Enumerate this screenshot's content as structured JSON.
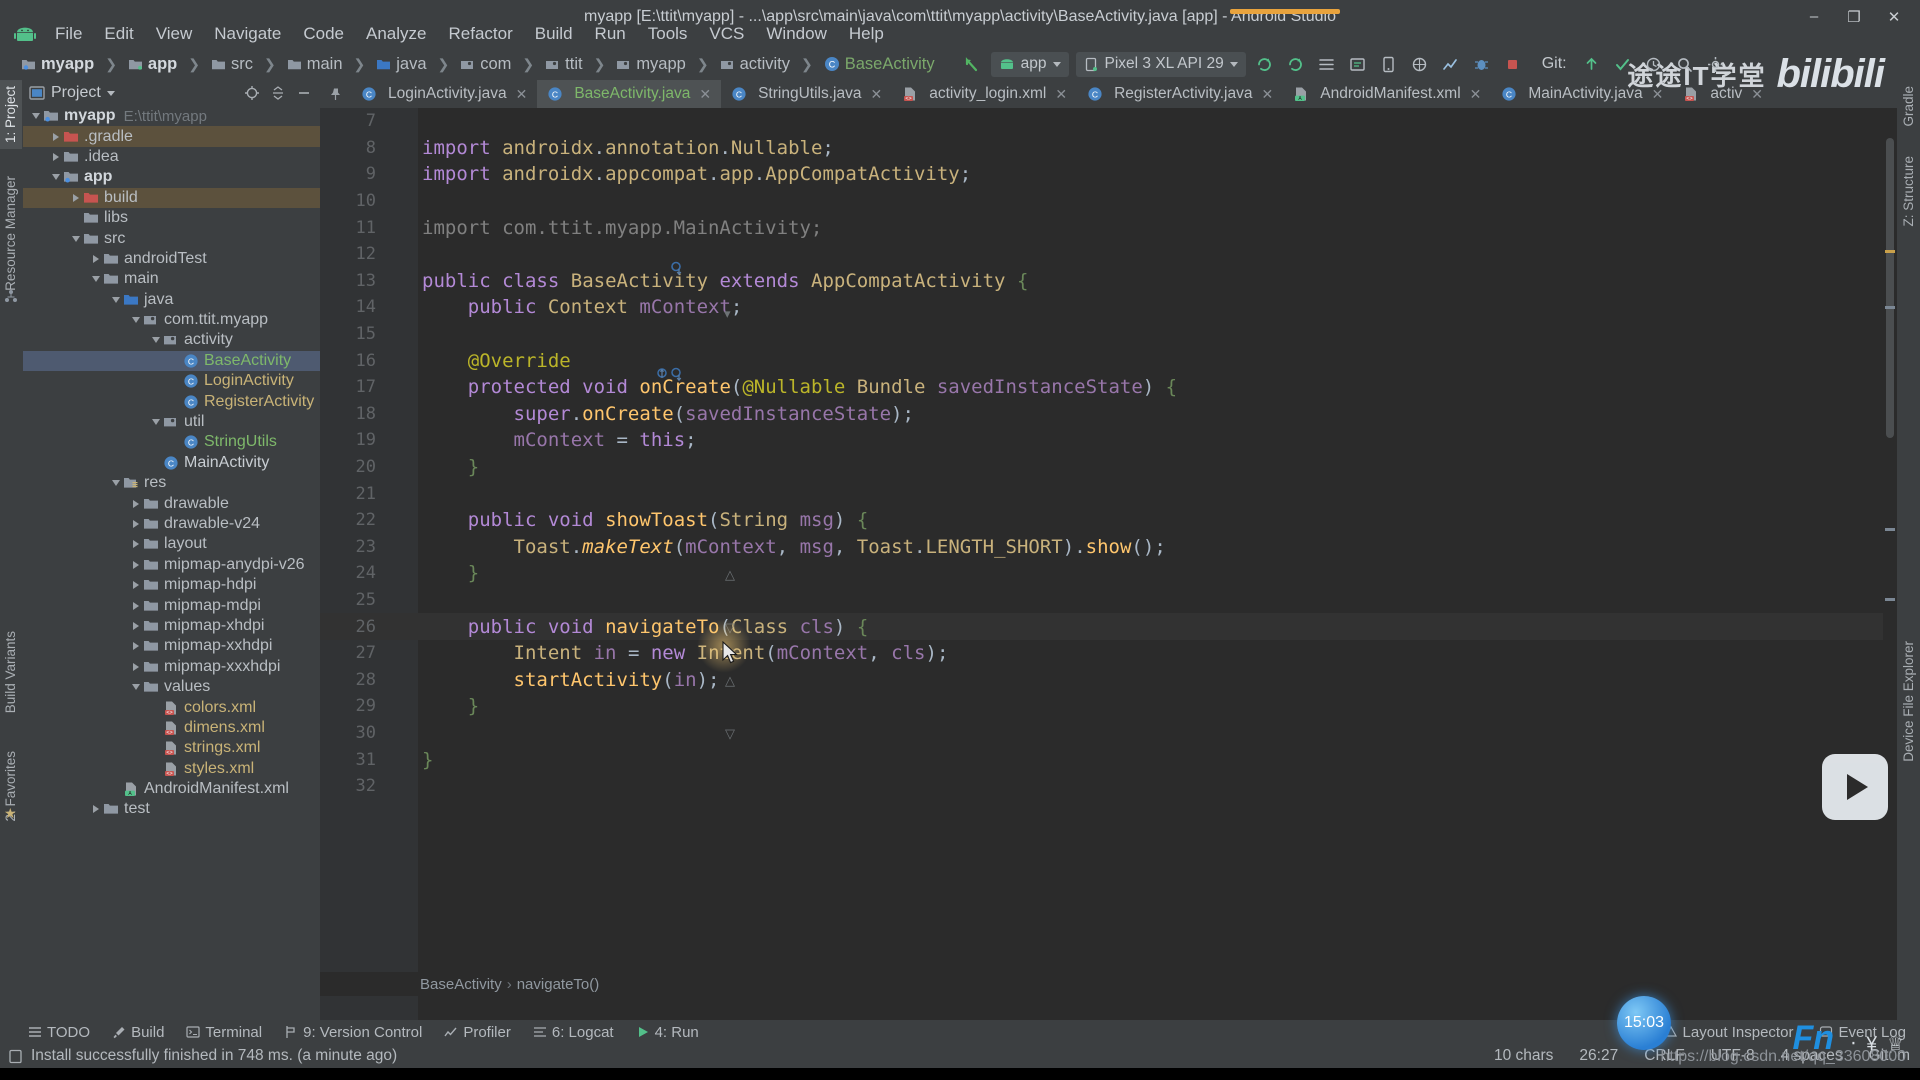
{
  "window": {
    "title": "myapp [E:\\ttit\\myapp] - ...\\app\\src\\main\\java\\com\\ttit\\myapp\\activity\\BaseActivity.java [app] - Android Studio",
    "minimize": "–",
    "maximize": "❐",
    "close": "✕"
  },
  "menu": {
    "items": [
      "File",
      "Edit",
      "View",
      "Navigate",
      "Code",
      "Analyze",
      "Refactor",
      "Build",
      "Run",
      "Tools",
      "VCS",
      "Window",
      "Help"
    ]
  },
  "navbar": {
    "crumbs": [
      {
        "label": "myapp",
        "icon": "module-folder-icon",
        "style": "bold"
      },
      {
        "label": "app",
        "icon": "module-folder-icon",
        "style": "bold"
      },
      {
        "label": "src",
        "icon": "folder-icon",
        "style": "normal"
      },
      {
        "label": "main",
        "icon": "folder-icon",
        "style": "normal"
      },
      {
        "label": "java",
        "icon": "source-folder-icon",
        "style": "normal"
      },
      {
        "label": "com",
        "icon": "package-icon",
        "style": "normal"
      },
      {
        "label": "ttit",
        "icon": "package-icon",
        "style": "normal"
      },
      {
        "label": "myapp",
        "icon": "package-icon",
        "style": "normal"
      },
      {
        "label": "activity",
        "icon": "package-icon",
        "style": "normal"
      },
      {
        "label": "BaseActivity",
        "icon": "class-icon",
        "style": "green"
      }
    ],
    "module_selector": "app",
    "device_selector": "Pixel 3 XL API 29",
    "git_label": "Git:",
    "icons": [
      "back-arrow-icon",
      "sync-project-icon",
      "avd-manager-icon",
      "sdk-manager-icon",
      "layout-inspector-icon",
      "profiler-icon",
      "run-icon",
      "debug-icon",
      "stop-icon",
      "search-icon",
      "settings-icon"
    ]
  },
  "left_strips": {
    "top": [
      "1: Project",
      "Resource Manager"
    ],
    "bottom": [
      "Build Variants",
      "2: Favorites"
    ]
  },
  "right_strips": [
    "Gradle",
    "Z: Structure",
    "Device File Explorer"
  ],
  "project_panel": {
    "title": "Project",
    "tree": [
      {
        "depth": 0,
        "arrow": "down",
        "icon": "module-folder-icon",
        "label": "myapp",
        "path": "E:\\ttit\\myapp",
        "style": "bold",
        "state": "normal"
      },
      {
        "depth": 1,
        "arrow": "right",
        "icon": "excluded-folder-icon",
        "label": ".gradle",
        "style": "normal",
        "state": "highlight"
      },
      {
        "depth": 1,
        "arrow": "right",
        "icon": "folder-icon",
        "label": ".idea",
        "style": "normal",
        "state": "normal"
      },
      {
        "depth": 1,
        "arrow": "down",
        "icon": "module-folder-icon",
        "label": "app",
        "style": "bold",
        "state": "normal"
      },
      {
        "depth": 2,
        "arrow": "right",
        "icon": "excluded-folder-icon",
        "label": "build",
        "style": "normal",
        "state": "highlight"
      },
      {
        "depth": 2,
        "arrow": "none",
        "icon": "folder-icon",
        "label": "libs",
        "style": "normal",
        "state": "normal"
      },
      {
        "depth": 2,
        "arrow": "down",
        "icon": "folder-icon",
        "label": "src",
        "style": "normal",
        "state": "normal"
      },
      {
        "depth": 3,
        "arrow": "right",
        "icon": "folder-icon",
        "label": "androidTest",
        "style": "normal",
        "state": "normal"
      },
      {
        "depth": 3,
        "arrow": "down",
        "icon": "folder-icon",
        "label": "main",
        "style": "normal",
        "state": "normal"
      },
      {
        "depth": 4,
        "arrow": "down",
        "icon": "source-folder-icon",
        "label": "java",
        "style": "normal",
        "state": "normal"
      },
      {
        "depth": 5,
        "arrow": "down",
        "icon": "package-icon",
        "label": "com.ttit.myapp",
        "style": "normal",
        "state": "normal"
      },
      {
        "depth": 6,
        "arrow": "down",
        "icon": "package-icon",
        "label": "activity",
        "style": "normal",
        "state": "normal"
      },
      {
        "depth": 7,
        "arrow": "none",
        "icon": "class-icon",
        "label": "BaseActivity",
        "style": "green",
        "state": "selected"
      },
      {
        "depth": 7,
        "arrow": "none",
        "icon": "class-icon",
        "label": "LoginActivity",
        "style": "tan",
        "state": "normal"
      },
      {
        "depth": 7,
        "arrow": "none",
        "icon": "class-icon",
        "label": "RegisterActivity",
        "style": "tan",
        "state": "normal"
      },
      {
        "depth": 6,
        "arrow": "down",
        "icon": "package-icon",
        "label": "util",
        "style": "normal",
        "state": "normal"
      },
      {
        "depth": 7,
        "arrow": "none",
        "icon": "class-icon",
        "label": "StringUtils",
        "style": "green",
        "state": "normal"
      },
      {
        "depth": 6,
        "arrow": "none",
        "icon": "class-icon",
        "label": "MainActivity",
        "style": "white",
        "state": "normal"
      },
      {
        "depth": 4,
        "arrow": "down",
        "icon": "res-folder-icon",
        "label": "res",
        "style": "normal",
        "state": "normal"
      },
      {
        "depth": 5,
        "arrow": "right",
        "icon": "folder-icon",
        "label": "drawable",
        "style": "normal",
        "state": "normal"
      },
      {
        "depth": 5,
        "arrow": "right",
        "icon": "folder-icon",
        "label": "drawable-v24",
        "style": "normal",
        "state": "normal"
      },
      {
        "depth": 5,
        "arrow": "right",
        "icon": "folder-icon",
        "label": "layout",
        "style": "normal",
        "state": "normal"
      },
      {
        "depth": 5,
        "arrow": "right",
        "icon": "folder-icon",
        "label": "mipmap-anydpi-v26",
        "style": "normal",
        "state": "normal"
      },
      {
        "depth": 5,
        "arrow": "right",
        "icon": "folder-icon",
        "label": "mipmap-hdpi",
        "style": "normal",
        "state": "normal"
      },
      {
        "depth": 5,
        "arrow": "right",
        "icon": "folder-icon",
        "label": "mipmap-mdpi",
        "style": "normal",
        "state": "normal"
      },
      {
        "depth": 5,
        "arrow": "right",
        "icon": "folder-icon",
        "label": "mipmap-xhdpi",
        "style": "normal",
        "state": "normal"
      },
      {
        "depth": 5,
        "arrow": "right",
        "icon": "folder-icon",
        "label": "mipmap-xxhdpi",
        "style": "normal",
        "state": "normal"
      },
      {
        "depth": 5,
        "arrow": "right",
        "icon": "folder-icon",
        "label": "mipmap-xxxhdpi",
        "style": "normal",
        "state": "normal"
      },
      {
        "depth": 5,
        "arrow": "down",
        "icon": "folder-icon",
        "label": "values",
        "style": "normal",
        "state": "normal"
      },
      {
        "depth": 6,
        "arrow": "none",
        "icon": "xml-file-icon",
        "label": "colors.xml",
        "style": "tan",
        "state": "normal"
      },
      {
        "depth": 6,
        "arrow": "none",
        "icon": "xml-file-icon",
        "label": "dimens.xml",
        "style": "tan",
        "state": "normal"
      },
      {
        "depth": 6,
        "arrow": "none",
        "icon": "xml-file-icon",
        "label": "strings.xml",
        "style": "tan",
        "state": "normal"
      },
      {
        "depth": 6,
        "arrow": "none",
        "icon": "xml-file-icon",
        "label": "styles.xml",
        "style": "tan",
        "state": "normal"
      },
      {
        "depth": 4,
        "arrow": "none",
        "icon": "manifest-file-icon",
        "label": "AndroidManifest.xml",
        "style": "normal",
        "state": "normal"
      },
      {
        "depth": 3,
        "arrow": "right",
        "icon": "folder-icon",
        "label": "test",
        "style": "normal",
        "state": "normal"
      }
    ]
  },
  "editor": {
    "tabs": [
      {
        "label": "LoginActivity.java",
        "icon": "java-class-icon",
        "active": false,
        "close": "✕"
      },
      {
        "label": "BaseActivity.java",
        "icon": "java-class-icon",
        "active": true,
        "close": "✕"
      },
      {
        "label": "StringUtils.java",
        "icon": "java-class-icon",
        "active": false,
        "close": "✕"
      },
      {
        "label": "activity_login.xml",
        "icon": "xml-file-icon",
        "active": false,
        "close": "✕"
      },
      {
        "label": "RegisterActivity.java",
        "icon": "java-class-icon",
        "active": false,
        "close": "✕"
      },
      {
        "label": "AndroidManifest.xml",
        "icon": "manifest-file-icon",
        "active": false,
        "close": "✕"
      },
      {
        "label": "MainActivity.java",
        "icon": "java-class-icon",
        "active": false,
        "close": "✕"
      },
      {
        "label": "activ",
        "icon": "xml-file-icon",
        "active": false,
        "close": "✕"
      }
    ],
    "breadcrumb": [
      "BaseActivity",
      "navigateTo()"
    ],
    "lines": [
      {
        "n": 7,
        "text": "",
        "current": false
      },
      {
        "n": 8,
        "text": "import androidx.annotation.Nullable;",
        "current": false
      },
      {
        "n": 9,
        "text": "import androidx.appcompat.app.AppCompatActivity;",
        "current": false
      },
      {
        "n": 10,
        "text": "",
        "current": false
      },
      {
        "n": 11,
        "text": "import com.ttit.myapp.MainActivity;",
        "current": false
      },
      {
        "n": 12,
        "text": "",
        "current": false
      },
      {
        "n": 13,
        "text": "public class BaseActivity extends AppCompatActivity {",
        "current": false
      },
      {
        "n": 14,
        "text": "    public Context mContext;",
        "current": false
      },
      {
        "n": 15,
        "text": "",
        "current": false
      },
      {
        "n": 16,
        "text": "    @Override",
        "current": false
      },
      {
        "n": 17,
        "text": "    protected void onCreate(@Nullable Bundle savedInstanceState) {",
        "current": false
      },
      {
        "n": 18,
        "text": "        super.onCreate(savedInstanceState);",
        "current": false
      },
      {
        "n": 19,
        "text": "        mContext = this;",
        "current": false
      },
      {
        "n": 20,
        "text": "    }",
        "current": false
      },
      {
        "n": 21,
        "text": "",
        "current": false
      },
      {
        "n": 22,
        "text": "    public void showToast(String msg) {",
        "current": false
      },
      {
        "n": 23,
        "text": "        Toast.makeText(mContext, msg, Toast.LENGTH_SHORT).show();",
        "current": false
      },
      {
        "n": 24,
        "text": "    }",
        "current": false
      },
      {
        "n": 25,
        "text": "",
        "current": false
      },
      {
        "n": 26,
        "text": "    public void navigateTo(Class cls) {",
        "current": true
      },
      {
        "n": 27,
        "text": "        Intent in = new Intent(mContext, cls);",
        "current": false
      },
      {
        "n": 28,
        "text": "        startActivity(in);",
        "current": false
      },
      {
        "n": 29,
        "text": "    }",
        "current": false
      },
      {
        "n": 30,
        "text": "",
        "current": false
      },
      {
        "n": 31,
        "text": "}",
        "current": false
      },
      {
        "n": 32,
        "text": "",
        "current": false
      }
    ]
  },
  "tool_windows": {
    "left": [
      {
        "label": "TODO",
        "icon": "todo-icon"
      },
      {
        "label": "Build",
        "icon": "build-icon"
      },
      {
        "label": "Terminal",
        "icon": "terminal-icon"
      },
      {
        "label": "9: Version Control",
        "icon": "vcs-icon"
      },
      {
        "label": "Profiler",
        "icon": "profiler-icon"
      },
      {
        "label": "6: Logcat",
        "icon": "logcat-icon"
      },
      {
        "label": "4: Run",
        "icon": "run-icon"
      }
    ],
    "right": [
      {
        "label": "Layout Inspector",
        "icon": "layout-inspector-icon"
      },
      {
        "label": "Event Log",
        "icon": "event-log-icon"
      }
    ]
  },
  "status_bar": {
    "message": "Install successfully finished in 748 ms. (a minute ago)",
    "chars": "10 chars",
    "caret": "26:27",
    "line_separator": "CRLF",
    "encoding": "UTF-8",
    "indent": "4 spaces",
    "git_branch": "Git: m"
  },
  "watermarks": {
    "brand_text": "途途IT学堂",
    "bilibili": "bilibili",
    "csdn_url": "https://blog.csdn.net/qq_33608000",
    "clock": "15:03",
    "ime": "Fn"
  },
  "colors": {
    "accent_blue": "#3b6ea8",
    "editor_bg": "#2b2b2b",
    "panel_bg": "#3c3f41",
    "selection": "#4e5a70",
    "keyword": "#cc7832",
    "string": "#6a8759",
    "method": "#ffc66d",
    "field": "#9876aa",
    "number": "#6897bb"
  }
}
